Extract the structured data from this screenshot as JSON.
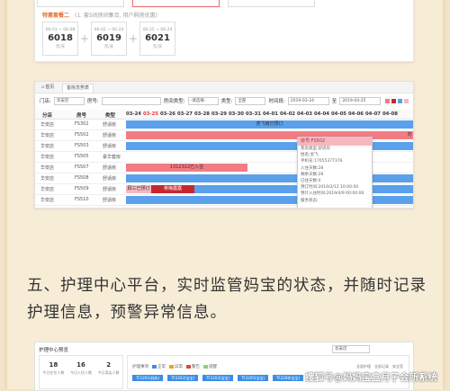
{
  "panel1": {
    "tag": "特惠套餐二",
    "hint": "(1. 套5间房间集合, 用户购房优惠)",
    "cards": [
      {
        "dates": "06-01 ~ 06-08",
        "price": "6018",
        "unit": "元/天"
      },
      {
        "dates": "06-02 ~ 06-24",
        "price": "6019",
        "unit": "元/天"
      },
      {
        "dates": "06-25 ~ 06-24",
        "price": "6021",
        "unit": "元/天"
      }
    ]
  },
  "panel2": {
    "tabs": {
      "home": "首页",
      "active": "客房态势表"
    },
    "filters": {
      "store_label": "门店:",
      "store_value": "华安店",
      "room_label": "房号:",
      "room_value": "",
      "roomtype_label": "房间类型:",
      "roomtype_value": "-请选择-",
      "type_label": "类型:",
      "type_value": "全部",
      "time_label": "时间段:",
      "time_from": "2019-03-24",
      "time_sep": "至",
      "time_to": "2019-04-25"
    },
    "headers": {
      "store": "分店",
      "room": "房号",
      "type": "类型"
    },
    "dates": [
      "03-24",
      "03-25",
      "03-26",
      "03-27",
      "03-28",
      "03-29",
      "03-30",
      "03-31",
      "04-01",
      "04-02",
      "04-03",
      "04-04",
      "04-05",
      "04-06",
      "04-07",
      "04-08"
    ],
    "today": "03-25",
    "rows": [
      {
        "store": "华安店",
        "room": "FS302",
        "type": "舒适房"
      },
      {
        "store": "华安店",
        "room": "FS502",
        "type": "舒适房"
      },
      {
        "store": "华安店",
        "room": "FS503",
        "type": "舒适房"
      },
      {
        "store": "华安店",
        "room": "FS505",
        "type": "豪华套房"
      },
      {
        "store": "华安店",
        "room": "FS507",
        "type": "舒适房"
      },
      {
        "store": "华安店",
        "room": "FS508",
        "type": "舒适房"
      },
      {
        "store": "华安店",
        "room": "FS509",
        "type": "舒适房"
      },
      {
        "store": "华安店",
        "room": "FS510",
        "type": "舒适房"
      }
    ],
    "bars": {
      "r1": "虎飞雨已预订",
      "r5": "1312312已入住",
      "r7a": "顾三已预订",
      "r7b": "蒋梅露露",
      "r2_end": "刘"
    },
    "tooltip": {
      "head": "房号:FS502",
      "lines": [
        "客房类型:舒适房",
        "姓名:虎飞",
        "手机号:17055377376",
        "入住天数:28",
        "剩余天数:28",
        "已住天数:0",
        "预订时间:2019/3/12 10:00:00",
        "预计入住时间:2019/4/9 00:00:00",
        "服务状态:"
      ]
    }
  },
  "heading": "五、护理中心平台，实时监管妈宝的状态，并随时记录护理信息，预警异常信息。",
  "panel3": {
    "title": "护理中心预览",
    "select": "华安店",
    "stats": [
      {
        "value": "18",
        "label": "今日在住人数"
      },
      {
        "value": "16",
        "label": "今日入住人数"
      },
      {
        "value": "2",
        "label": "今日离店人数"
      }
    ],
    "legend_title": "护理事项",
    "legend": [
      {
        "label": "正常",
        "color": "#3a8ee6"
      },
      {
        "label": "异常",
        "color": "#f0a020"
      },
      {
        "label": "警告",
        "color": "#e04848"
      },
      {
        "label": "提醒",
        "color": "#8fd16b"
      }
    ],
    "rooms": [
      "TF2201(妈妈)",
      "TF2202(宝宝)",
      "TF2203(宝宝)",
      "TF2205(宝宝)",
      "TF2208(宝宝)"
    ],
    "right": [
      "全部护理",
      "全部记录",
      "安全室"
    ]
  },
  "watermark": "搜狐号@妈妈宝盒月子会所系统",
  "colors": {
    "blue_bar": "#5aa0ea",
    "red_bar": "#f27c84",
    "red_dark": "#c8262f",
    "pink_tip": "#f6b7c0",
    "today": "#e03a3a",
    "bg": "#f1e4ca"
  }
}
